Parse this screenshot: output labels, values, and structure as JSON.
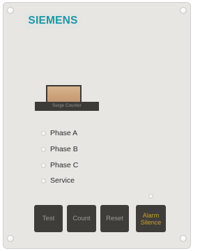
{
  "panel": {
    "brand": "SIEMENS",
    "counter_label": "Surge Counter"
  },
  "indicators": [
    {
      "label": "Phase A"
    },
    {
      "label": "Phase B"
    },
    {
      "label": "Phase C"
    },
    {
      "label": "Service"
    }
  ],
  "buttons": {
    "test": "Test",
    "count": "Count",
    "reset": "Reset",
    "alarm_line1": "Alarm",
    "alarm_line2": "Silence"
  },
  "colors": {
    "brand": "#1b96a6",
    "plate": "#e7e6e2",
    "button": "#3e3d3a",
    "alarm_text": "#c9a028"
  }
}
